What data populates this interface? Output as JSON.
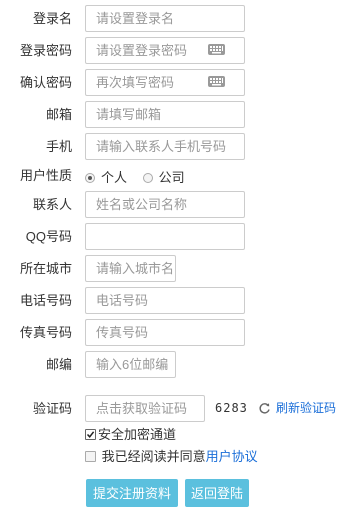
{
  "form": {
    "username": {
      "label": "登录名",
      "placeholder": "请设置登录名"
    },
    "password": {
      "label": "登录密码",
      "placeholder": "请设置登录密码",
      "icon": "keyboard-icon"
    },
    "confirm": {
      "label": "确认密码",
      "placeholder": "再次填写密码",
      "icon": "keyboard-icon"
    },
    "email": {
      "label": "邮箱",
      "placeholder": "请填写邮箱"
    },
    "mobile": {
      "label": "手机",
      "placeholder": "请输入联系人手机号码"
    },
    "user_type": {
      "label": "用户性质",
      "options": [
        "个人",
        "公司"
      ],
      "selected": "个人"
    },
    "contact": {
      "label": "联系人",
      "placeholder": "姓名或公司名称"
    },
    "qq": {
      "label": "QQ号码",
      "placeholder": ""
    },
    "city": {
      "label": "所在城市",
      "placeholder": "请输入城市名"
    },
    "phone": {
      "label": "电话号码",
      "placeholder": "电话号码"
    },
    "fax": {
      "label": "传真号码",
      "placeholder": "传真号码"
    },
    "postcode": {
      "label": "邮编",
      "placeholder": "输入6位邮编"
    },
    "captcha": {
      "label": "验证码",
      "placeholder": "点击获取验证码",
      "code": "6283",
      "refresh_label": "刷新验证码",
      "icon": "refresh-icon"
    },
    "secure_channel": {
      "label": "安全加密通道",
      "checked": true
    },
    "agreement": {
      "prefix": "我已经阅读并同意",
      "link": "用户协议",
      "checked": false
    },
    "submit_label": "提交注册资料",
    "back_label": "返回登陆"
  },
  "colors": {
    "accent_button": "#5bc0de",
    "link": "#1a6ed8",
    "border": "#cccccc",
    "placeholder": "#999999"
  }
}
